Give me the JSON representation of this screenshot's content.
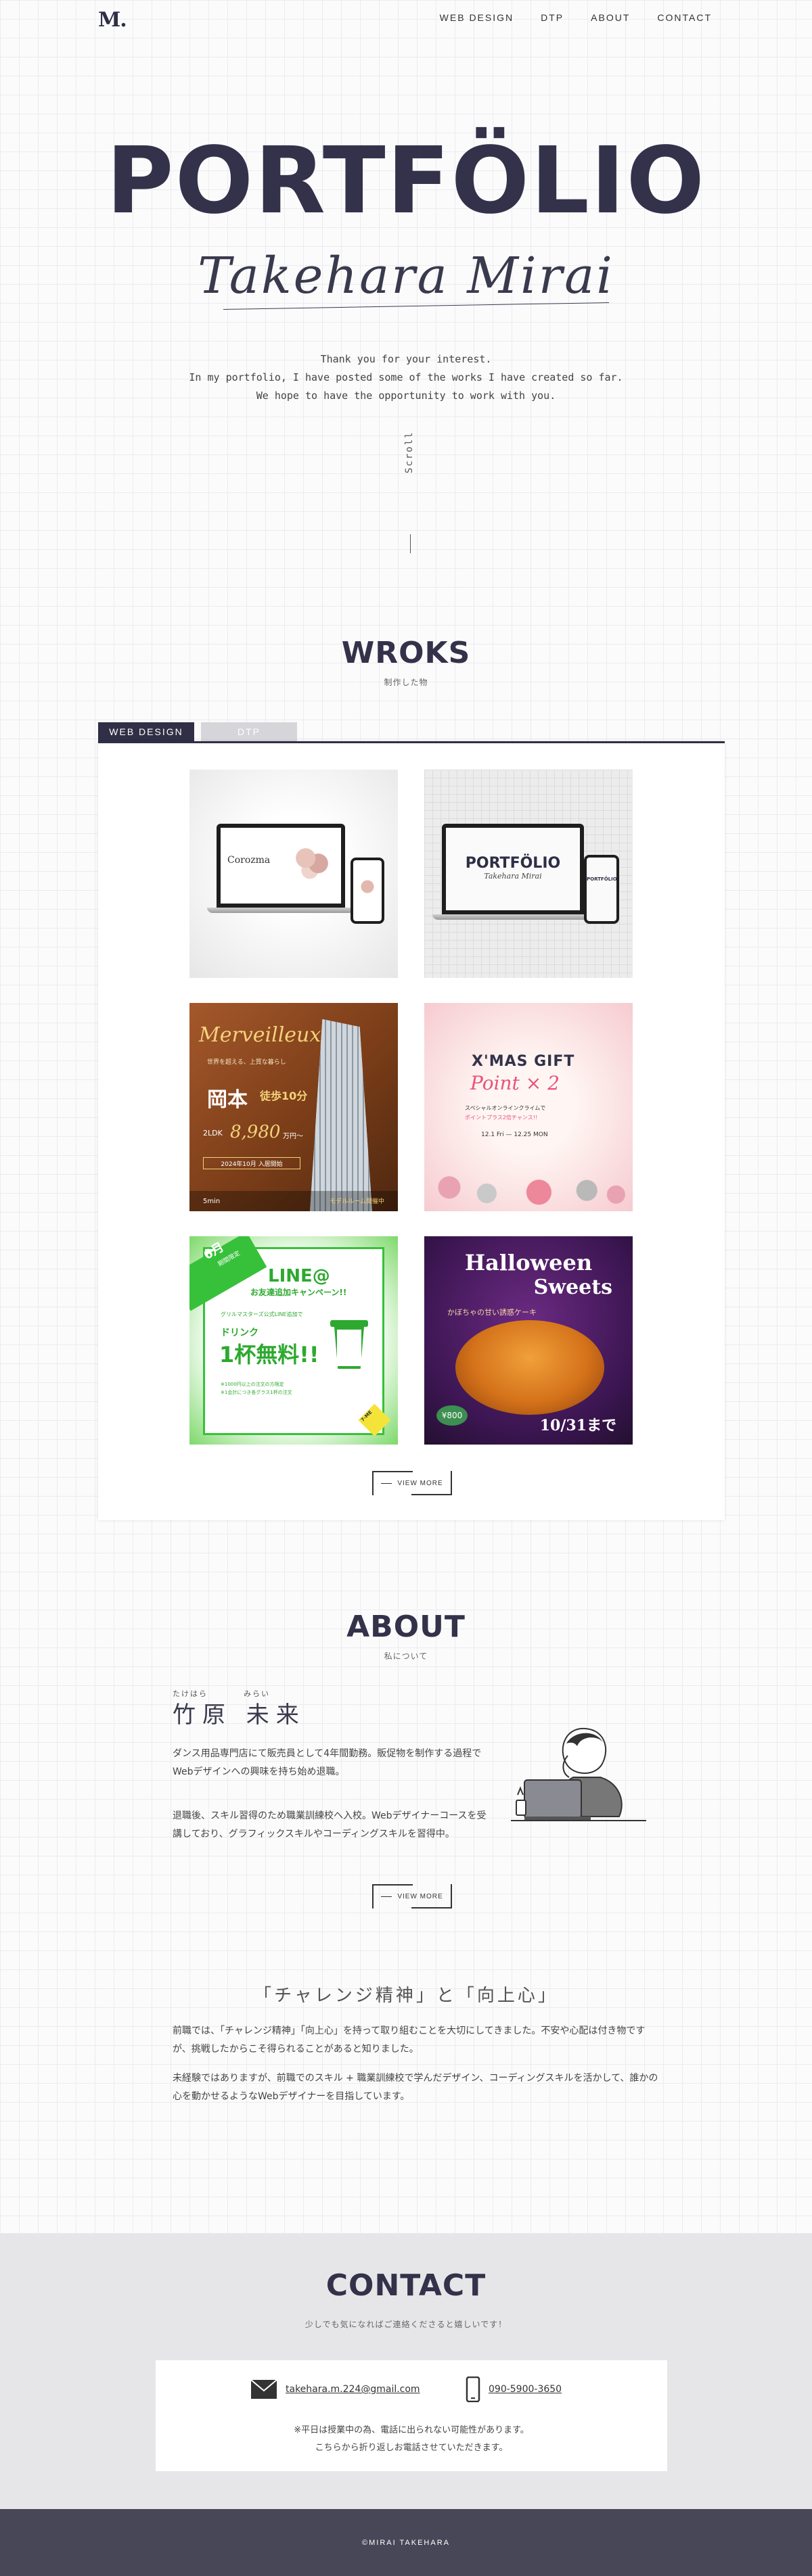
{
  "header": {
    "logo": "M.",
    "nav": [
      "WEB DESIGN",
      "DTP",
      "ABOUT",
      "CONTACT"
    ]
  },
  "hero": {
    "title": "PORTFÖLIO",
    "script_name": "Takehara Mirai",
    "intro": [
      "Thank you for your interest.",
      "In my portfolio, I have posted some of the works I have created so far.",
      "We hope to have the opportunity to work with you."
    ],
    "scroll_label": "Scroll"
  },
  "works": {
    "title": "WROKS",
    "subtitle": "制作した物",
    "tabs": [
      "WEB DESIGN",
      "DTP"
    ],
    "items": [
      {
        "caption": "Corozma"
      },
      {
        "title": "PORTFÖLIO",
        "subtitle": "Takehara Mirai"
      },
      {
        "brand": "Merveilleux",
        "tagline": "世界を超える、上質な暮らし",
        "name": "岡本",
        "walk": "徒歩10分",
        "price_label": "2LDK",
        "price": "8,980",
        "price_unit": "万円〜",
        "date": "2024年10月 入居開始",
        "note1": "5min",
        "note2": "モデルルーム開催中"
      },
      {
        "title": "X'MAS GIFT",
        "point": "Point × 2",
        "sub1": "スペシャルオンラインクライムで",
        "sub2": "ポイントプラス2倍チャンス!!",
        "date": "12.1 Fri — 12.25 MON"
      },
      {
        "badge": "6月",
        "badge_sub": "期間限定",
        "title": "LINE@",
        "sub": "お友達追加キャンペーン!!",
        "sub2": "グリルマスターズ公式LINE追加で",
        "drink": "ドリンク",
        "free": "1杯無料!!",
        "note1": "※1000円以上の注文の方限定",
        "note2": "※1会計につき各グラス1杯の注文",
        "corner": "7-ME"
      },
      {
        "title1": "Halloween",
        "title2": "Sweets",
        "copy": "かぼちゃの甘い誘惑ケーキ",
        "price": "¥800",
        "date": "10/31まで"
      }
    ],
    "view_more": "VIEW MORE"
  },
  "about": {
    "title": "ABOUT",
    "subtitle": "私について",
    "ruby1": "たけはら",
    "ruby2": "みらい",
    "name": "竹原 未来",
    "p1": "ダンス用品専門店にて販売員として4年間勤務。販促物を制作する過程でWebデザインへの興味を持ち始め退職。",
    "p2": "退職後、スキル習得のため職業訓練校へ入校。Webデザイナーコースを受講しており、グラフィックスキルやコーディングスキルを習得中。",
    "view_more": "VIEW MORE",
    "challenge_title": "「チャレンジ精神」と「向上心」",
    "challenge_p1": "前職では、「チャレンジ精神」「向上心」を持って取り組むことを大切にしてきました。不安や心配は付き物ですが、挑戦したからこそ得られることがあると知りました。",
    "challenge_p2": "未経験ではありますが、前職でのスキル + 職業訓練校で学んだデザイン、コーディングスキルを活かして、誰かの心を動かせるようなWebデザイナーを目指しています。"
  },
  "contact": {
    "title": "CONTACT",
    "subtitle": "少しでも気になればご連絡くださると嬉しいです！",
    "email": "takehara.m.224@gmail.com",
    "phone": "090-5900-3650",
    "note1": "※平日は授業中の為、電話に出られない可能性があります。",
    "note2": "こちらから折り返しお電話させていただきます。"
  },
  "footer": {
    "copyright": "©MIRAI TAKEHARA"
  },
  "colors": {
    "navy": "#2f2f46",
    "gray_tab": "#d6d6da",
    "contact_bg": "#e6e6e8",
    "footer_bg": "#484758"
  }
}
